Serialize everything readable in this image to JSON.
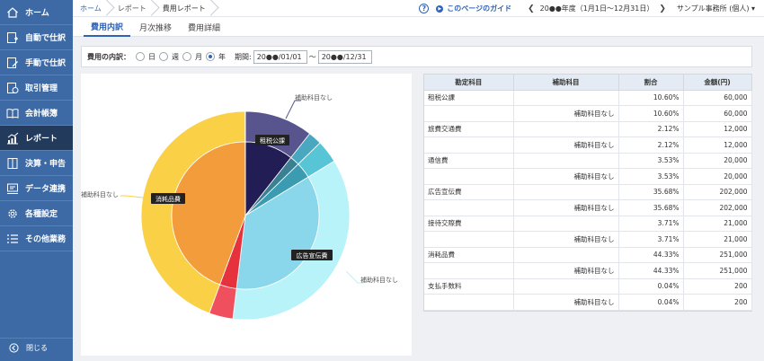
{
  "sidebar": {
    "items": [
      {
        "label": "ホーム",
        "icon": "home-icon"
      },
      {
        "label": "自動で仕訳",
        "icon": "auto-entry-icon"
      },
      {
        "label": "手動で仕訳",
        "icon": "manual-entry-icon"
      },
      {
        "label": "取引管理",
        "icon": "transaction-icon"
      },
      {
        "label": "会計帳簿",
        "icon": "ledger-icon"
      },
      {
        "label": "レポート",
        "icon": "report-chart-icon"
      },
      {
        "label": "決算・申告",
        "icon": "settlement-icon"
      },
      {
        "label": "データ連携",
        "icon": "data-link-icon"
      },
      {
        "label": "各種設定",
        "icon": "gear-icon"
      },
      {
        "label": "その他業務",
        "icon": "list-icon"
      }
    ],
    "active_index": 5,
    "close_label": "閉じる"
  },
  "header": {
    "breadcrumb": [
      "ホーム",
      "レポート",
      "費用レポート"
    ],
    "guide_label": "このページのガイド",
    "fiscal_year": "20●●年度（1月1日〜12月31日）",
    "office": "サンプル事務所 (個人)"
  },
  "tabs": [
    "費用内訳",
    "月次推移",
    "費用詳細"
  ],
  "filter": {
    "label": "費用の内訳：",
    "options": [
      "日",
      "週",
      "月",
      "年"
    ],
    "selected": "年",
    "period_label": "期間:",
    "start_date": "20●●/01/01",
    "end_date": "20●●/12/31",
    "tilde": "〜"
  },
  "table": {
    "headers": [
      "勘定科目",
      "補助科目",
      "割合",
      "金額(円)"
    ],
    "rows": [
      [
        "租税公課",
        "",
        "10.60%",
        "60,000"
      ],
      [
        "",
        "補助科目なし",
        "10.60%",
        "60,000"
      ],
      [
        "旅費交通費",
        "",
        "2.12%",
        "12,000"
      ],
      [
        "",
        "補助科目なし",
        "2.12%",
        "12,000"
      ],
      [
        "通信費",
        "",
        "3.53%",
        "20,000"
      ],
      [
        "",
        "補助科目なし",
        "3.53%",
        "20,000"
      ],
      [
        "広告宣伝費",
        "",
        "35.68%",
        "202,000"
      ],
      [
        "",
        "補助科目なし",
        "35.68%",
        "202,000"
      ],
      [
        "接待交際費",
        "",
        "3.71%",
        "21,000"
      ],
      [
        "",
        "補助科目なし",
        "3.71%",
        "21,000"
      ],
      [
        "消耗品費",
        "",
        "44.33%",
        "251,000"
      ],
      [
        "",
        "補助科目なし",
        "44.33%",
        "251,000"
      ],
      [
        "支払手数料",
        "",
        "0.04%",
        "200"
      ],
      [
        "",
        "補助科目なし",
        "0.04%",
        "200"
      ]
    ]
  },
  "chart_data": {
    "type": "pie",
    "title": "",
    "inner": {
      "categories": [
        "租税公課",
        "旅費交通費",
        "通信費",
        "広告宣伝費",
        "接待交際費",
        "消耗品費",
        "支払手数料"
      ],
      "values": [
        60000,
        12000,
        20000,
        202000,
        21000,
        251000,
        200
      ],
      "colors": [
        "#221e55",
        "#3b7f93",
        "#3b9bb0",
        "#8ad6ea",
        "#e5323c",
        "#f39c3b",
        "#f7c33d"
      ]
    },
    "outer": {
      "categories": [
        "租税公課 / 補助科目なし",
        "旅費交通費 / 補助科目なし",
        "通信費 / 補助科目なし",
        "広告宣伝費 / 補助科目なし",
        "接待交際費 / 補助科目なし",
        "消耗品費 / 補助科目なし",
        "支払手数料 / 補助科目なし"
      ],
      "values": [
        60000,
        12000,
        20000,
        202000,
        21000,
        251000,
        200
      ],
      "colors": [
        "#57548e",
        "#4aa7c0",
        "#57c5d6",
        "#b7f3f8",
        "#f0505d",
        "#fad047",
        "#fad047"
      ]
    },
    "inner_labels": [
      "租税公課",
      "広告宣伝費",
      "消耗品費"
    ],
    "outer_callouts": [
      "補助科目なし",
      "補助科目なし",
      "補助科目なし"
    ]
  }
}
